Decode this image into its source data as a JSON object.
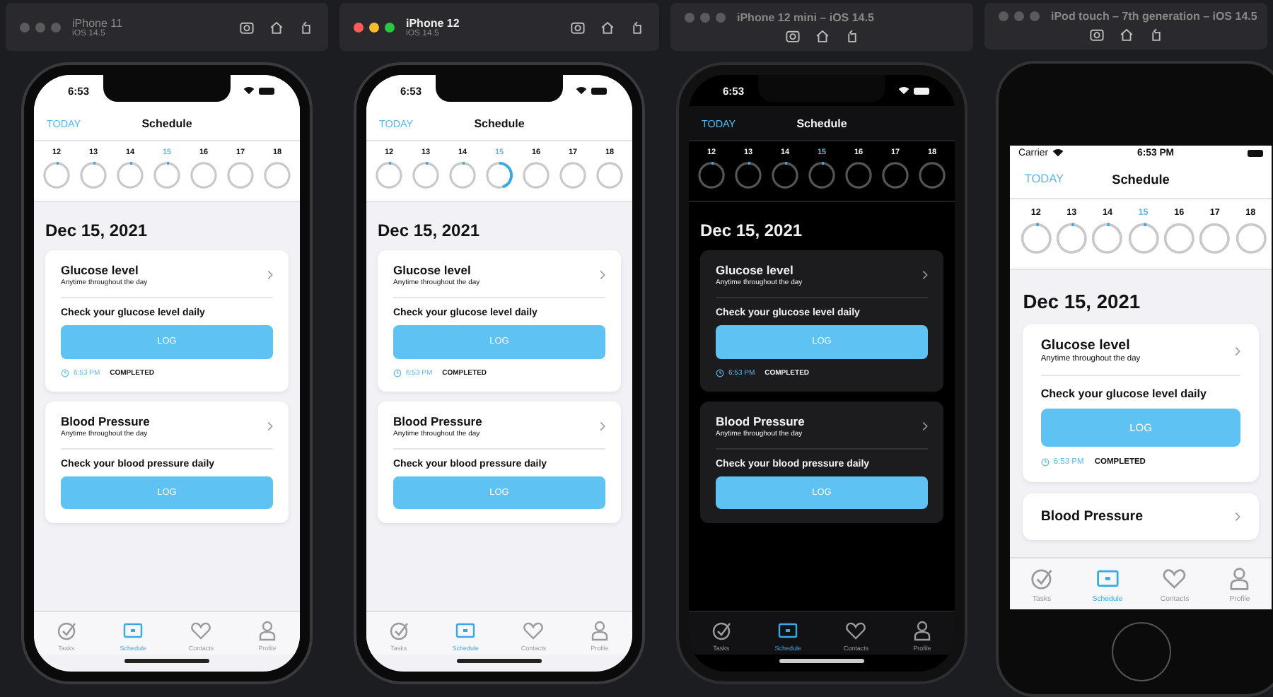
{
  "simulators": [
    {
      "title": "iPhone 11",
      "subtitle": "iOS 14.5",
      "focused": false,
      "kind": "notch",
      "dark": false,
      "status": {
        "time": "6:53"
      },
      "nav": {
        "today": "TODAY",
        "title": "Schedule"
      },
      "days": [
        {
          "label": "12",
          "selected": false,
          "level": 0.03
        },
        {
          "label": "13",
          "selected": false,
          "level": 0.03
        },
        {
          "label": "14",
          "selected": false,
          "level": 0.03
        },
        {
          "label": "15",
          "selected": true,
          "level": 0.03
        },
        {
          "label": "16",
          "selected": false,
          "level": 0
        },
        {
          "label": "17",
          "selected": false,
          "level": 0
        },
        {
          "label": "18",
          "selected": false,
          "level": 0
        }
      ],
      "date": "Dec 15, 2021",
      "tasks": [
        {
          "title": "Glucose level",
          "subtitle": "Anytime throughout the day",
          "instruction": "Check your glucose level daily",
          "button": "LOG",
          "time": "6:53 PM",
          "status": "COMPLETED"
        },
        {
          "title": "Blood Pressure",
          "subtitle": "Anytime throughout the day",
          "instruction": "Check your blood pressure daily",
          "button": "LOG"
        }
      ],
      "tabs": [
        {
          "label": "Tasks",
          "kind": "tasks",
          "selected": false
        },
        {
          "label": "Schedule",
          "kind": "schedule",
          "selected": true
        },
        {
          "label": "Contacts",
          "kind": "contacts",
          "selected": false
        },
        {
          "label": "Profile",
          "kind": "profile",
          "selected": false
        }
      ]
    },
    {
      "title": "iPhone 12",
      "subtitle": "iOS 14.5",
      "focused": true,
      "kind": "notch",
      "dark": false,
      "status": {
        "time": "6:53"
      },
      "nav": {
        "today": "TODAY",
        "title": "Schedule"
      },
      "days": [
        {
          "label": "12",
          "selected": false,
          "level": 0.03
        },
        {
          "label": "13",
          "selected": false,
          "level": 0.03
        },
        {
          "label": "14",
          "selected": false,
          "level": 0.03
        },
        {
          "label": "15",
          "selected": true,
          "level": 0.45
        },
        {
          "label": "16",
          "selected": false,
          "level": 0
        },
        {
          "label": "17",
          "selected": false,
          "level": 0
        },
        {
          "label": "18",
          "selected": false,
          "level": 0
        }
      ],
      "date": "Dec 15, 2021",
      "tasks": [
        {
          "title": "Glucose level",
          "subtitle": "Anytime throughout the day",
          "instruction": "Check your glucose level daily",
          "button": "LOG",
          "time": "6:53 PM",
          "status": "COMPLETED"
        },
        {
          "title": "Blood Pressure",
          "subtitle": "Anytime throughout the day",
          "instruction": "Check your blood pressure daily",
          "button": "LOG"
        }
      ],
      "tabs": [
        {
          "label": "Tasks",
          "kind": "tasks",
          "selected": false
        },
        {
          "label": "Schedule",
          "kind": "schedule",
          "selected": true
        },
        {
          "label": "Contacts",
          "kind": "contacts",
          "selected": false
        },
        {
          "label": "Profile",
          "kind": "profile",
          "selected": false
        }
      ]
    },
    {
      "title": "iPhone 12 mini – iOS 14.5",
      "focused": false,
      "kind": "notch",
      "dark": true,
      "status": {
        "time": "6:53"
      },
      "nav": {
        "today": "TODAY",
        "title": "Schedule"
      },
      "days": [
        {
          "label": "12",
          "selected": false,
          "level": 0.03
        },
        {
          "label": "13",
          "selected": false,
          "level": 0.03
        },
        {
          "label": "14",
          "selected": false,
          "level": 0.03
        },
        {
          "label": "15",
          "selected": true,
          "level": 0.03
        },
        {
          "label": "16",
          "selected": false,
          "level": 0
        },
        {
          "label": "17",
          "selected": false,
          "level": 0
        },
        {
          "label": "18",
          "selected": false,
          "level": 0
        }
      ],
      "date": "Dec 15, 2021",
      "tasks": [
        {
          "title": "Glucose level",
          "subtitle": "Anytime throughout the day",
          "instruction": "Check your glucose level daily",
          "button": "LOG",
          "time": "6:53 PM",
          "status": "COMPLETED"
        },
        {
          "title": "Blood Pressure",
          "subtitle": "Anytime throughout the day",
          "instruction": "Check your blood pressure daily",
          "button": "LOG"
        }
      ],
      "tabs": [
        {
          "label": "Tasks",
          "kind": "tasks",
          "selected": false
        },
        {
          "label": "Schedule",
          "kind": "schedule",
          "selected": true
        },
        {
          "label": "Contacts",
          "kind": "contacts",
          "selected": false
        },
        {
          "label": "Profile",
          "kind": "profile",
          "selected": false
        }
      ]
    },
    {
      "title": "iPod touch – 7th generation – iOS 14.5",
      "focused": false,
      "kind": "home_button",
      "dark": false,
      "status": {
        "carrier": "Carrier",
        "time": "6:53 PM"
      },
      "nav": {
        "today": "TODAY",
        "title": "Schedule"
      },
      "days": [
        {
          "label": "12",
          "selected": false,
          "level": 0.03
        },
        {
          "label": "13",
          "selected": false,
          "level": 0.03
        },
        {
          "label": "14",
          "selected": false,
          "level": 0.03
        },
        {
          "label": "15",
          "selected": true,
          "level": 0.03
        },
        {
          "label": "16",
          "selected": false,
          "level": 0
        },
        {
          "label": "17",
          "selected": false,
          "level": 0
        },
        {
          "label": "18",
          "selected": false,
          "level": 0
        }
      ],
      "date": "Dec 15, 2021",
      "tasks": [
        {
          "title": "Glucose level",
          "subtitle": "Anytime throughout the day",
          "instruction": "Check your glucose level daily",
          "button": "LOG",
          "time": "6:53 PM",
          "status": "COMPLETED"
        },
        {
          "title": "Blood Pressure"
        }
      ],
      "tabs": [
        {
          "label": "Tasks",
          "kind": "tasks",
          "selected": false
        },
        {
          "label": "Schedule",
          "kind": "schedule",
          "selected": true
        },
        {
          "label": "Contacts",
          "kind": "contacts",
          "selected": false
        },
        {
          "label": "Profile",
          "kind": "profile",
          "selected": false
        }
      ]
    }
  ]
}
